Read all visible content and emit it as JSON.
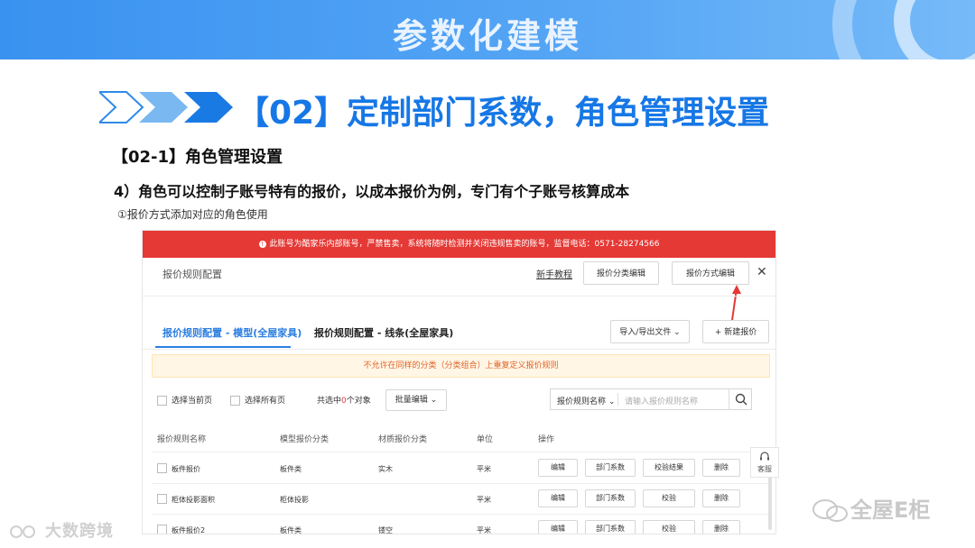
{
  "slide": {
    "title": "参数化建模",
    "section_title": "【02】定制部门系数，角色管理设置",
    "subsection": "【02-1】角色管理设置",
    "point": "4）角色可以控制子账号特有的报价，以成本报价为例，专门有个子账号核算成本",
    "note": "①报价方式添加对应的角色使用",
    "watermark_left": "大数跨境",
    "watermark_right": "全屋E柜"
  },
  "screenshot": {
    "alert_icon": "!",
    "alert": "此账号为酷家乐内部账号，严禁售卖，系统将随时检测并关闭违规售卖的账号，监督电话：0571-28274566",
    "dialog_title": "报价规则配置",
    "help_link": "新手教程",
    "btn_category": "报价分类编辑",
    "btn_method": "报价方式编辑",
    "close": "✕",
    "tabs": [
      "报价规则配置 - 模型(全屋家具)",
      "报价规则配置 - 线条(全屋家具)"
    ],
    "import_export": "导入/导出文件 ⌄",
    "new_quote": "+ 新建报价",
    "warning": "不允许在同样的分类（分类组合）上重复定义报价规则",
    "select_page": "选择当前页",
    "select_all": "选择所有页",
    "selected_prefix": "共选中",
    "selected_count": "0",
    "selected_suffix": "个对象",
    "batch_edit": "批量编辑 ⌄",
    "filter_label": "报价规则名称 ⌄",
    "search_placeholder": "请输入报价规则名称",
    "columns": [
      "报价规则名称",
      "模型报价分类",
      "材质报价分类",
      "单位",
      "操作"
    ],
    "rows": [
      {
        "name": "板件报价",
        "model": "板件类",
        "material": "实木",
        "unit": "平米",
        "actions": [
          "编辑",
          "部门系数",
          "校验结果",
          "删除"
        ]
      },
      {
        "name": "柜体投影面积",
        "model": "柜体投影",
        "material": "",
        "unit": "平米",
        "actions": [
          "编辑",
          "部门系数",
          "校验",
          "删除"
        ]
      },
      {
        "name": "板件报价2",
        "model": "板件类",
        "material": "镂空",
        "unit": "平米",
        "actions": [
          "编辑",
          "部门系数",
          "校验",
          "删除"
        ]
      }
    ],
    "kefu": "客服"
  },
  "colors": {
    "accent": "#2a7de1",
    "banner": "#3a92f0",
    "alert": "#e53935",
    "warning_text": "#e0642a"
  }
}
